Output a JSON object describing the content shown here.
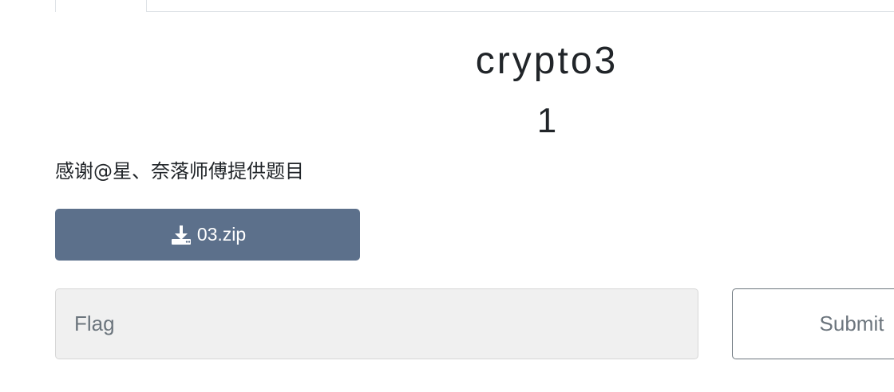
{
  "challenge": {
    "name": "crypto3",
    "value": "1",
    "description": "感谢@星、奈落师傅提供题目"
  },
  "files": [
    {
      "label": "03.zip",
      "icon": "download-icon"
    }
  ],
  "flag_input": {
    "placeholder": "Flag",
    "value": ""
  },
  "submit": {
    "label": "Submit"
  },
  "colors": {
    "download_button_bg": "#5c708b",
    "input_bg": "#f0f0f0",
    "text": "#212529"
  }
}
